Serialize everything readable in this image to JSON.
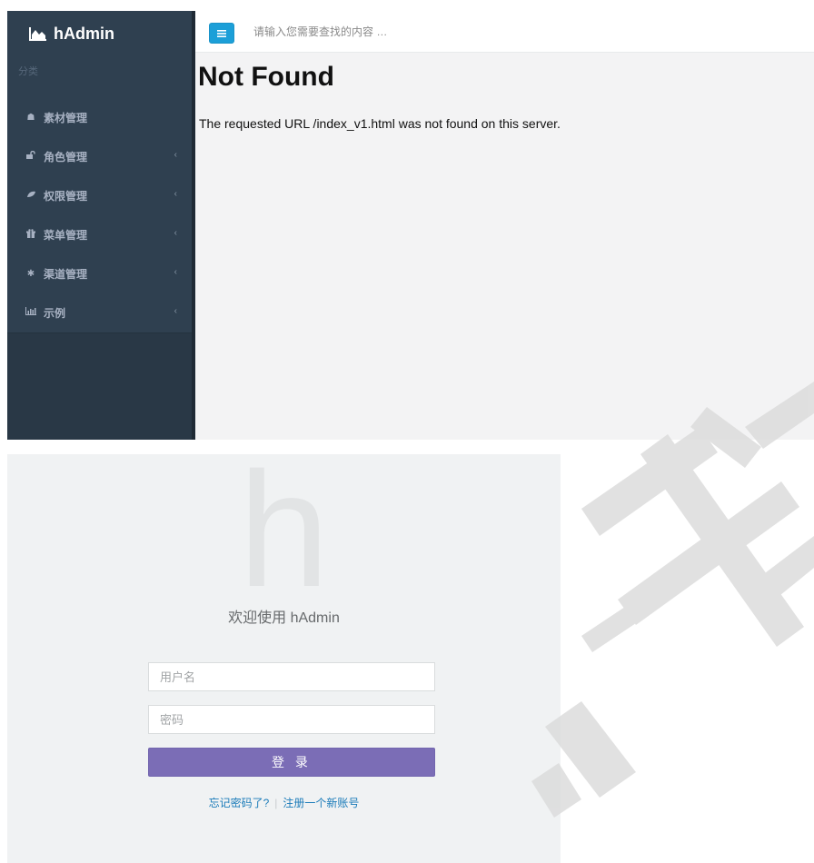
{
  "admin": {
    "brand": "hAdmin",
    "brand_icon": "area-chart-icon",
    "nav_header": "分类",
    "nav": [
      {
        "icon": "home-icon",
        "glyph": "☗",
        "label": "素材管理",
        "has_submenu": false
      },
      {
        "icon": "unlock-icon",
        "glyph": "🔓",
        "label": "角色管理",
        "has_submenu": true
      },
      {
        "icon": "leaf-icon",
        "glyph": "❦",
        "label": "权限管理",
        "has_submenu": true
      },
      {
        "icon": "gift-icon",
        "glyph": "🎁",
        "label": "菜单管理",
        "has_submenu": true
      },
      {
        "icon": "asterisk-icon",
        "glyph": "✱",
        "label": "渠道管理",
        "has_submenu": true
      },
      {
        "icon": "bar-chart-icon",
        "glyph": "▐",
        "label": "示例",
        "has_submenu": true
      }
    ],
    "chevron": "‹",
    "search_placeholder": "请输入您需要查找的内容 …",
    "error_title": "Not Found",
    "error_message": "The requested URL /index_v1.html was not found on this server."
  },
  "login": {
    "logo_letter": "h",
    "welcome": "欢迎使用 hAdmin",
    "username_placeholder": "用户名",
    "password_placeholder": "密码",
    "submit_label": "登 录",
    "forgot_link": "忘记密码了?",
    "register_link": "注册一个新账号",
    "link_separator": "|"
  },
  "colors": {
    "sidebar": "#2f4050",
    "accent_button": "#1c9fd8",
    "login_button": "#7b6db6",
    "link": "#1a7bb9"
  }
}
